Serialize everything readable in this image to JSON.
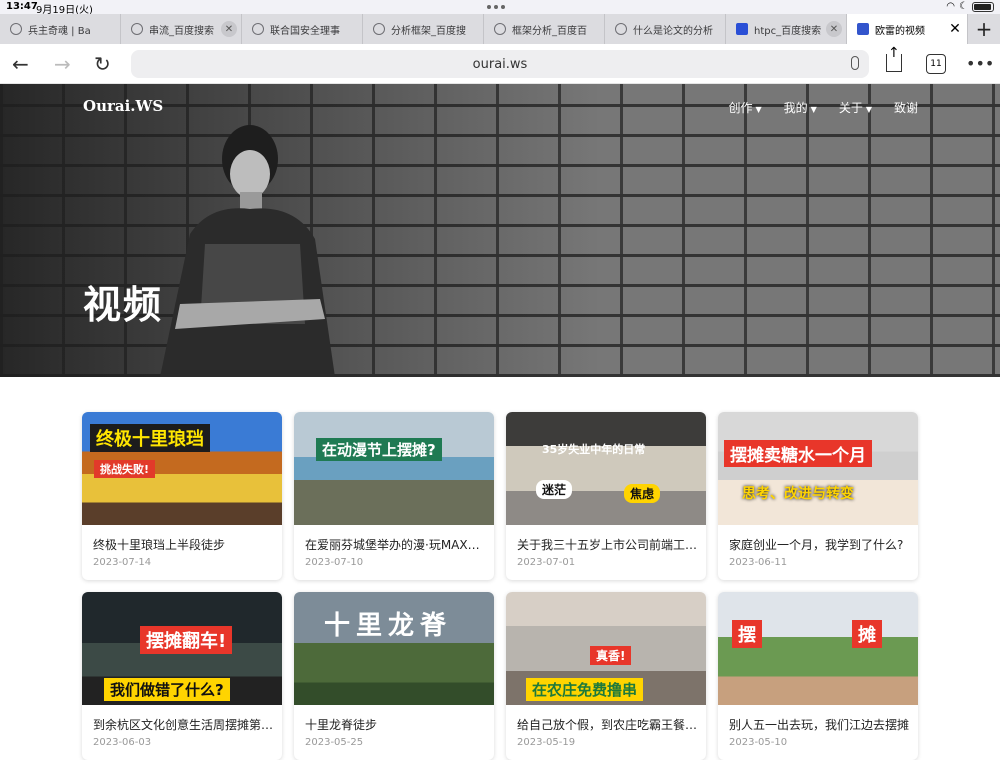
{
  "status": {
    "time": "13:47",
    "date": "9月19日(火)",
    "battery": "battery-icon"
  },
  "tabs": [
    {
      "label": "兵主奇魂 | Ba",
      "icon": "globe-icon",
      "active": false
    },
    {
      "label": "串流_百度搜索",
      "icon": "globe-icon",
      "active": false
    },
    {
      "label": "联合国安全理事",
      "icon": "globe-icon",
      "active": false
    },
    {
      "label": "分析框架_百度搜",
      "icon": "globe-icon",
      "active": false
    },
    {
      "label": "框架分析_百度百",
      "icon": "globe-icon",
      "active": false
    },
    {
      "label": "什么是论文的分析",
      "icon": "globe-icon",
      "active": false
    },
    {
      "label": "htpc_百度搜索",
      "icon": "baidu-icon",
      "active": false
    },
    {
      "label": "欧雷的视频",
      "icon": "site-icon",
      "active": true
    }
  ],
  "toolbar": {
    "url": "ourai.ws",
    "tab_count": "11"
  },
  "site": {
    "logo": "Ourai.WS",
    "nav": [
      {
        "label": "创作",
        "dropdown": true
      },
      {
        "label": "我的",
        "dropdown": true
      },
      {
        "label": "关于",
        "dropdown": true
      },
      {
        "label": "致谢",
        "dropdown": false
      }
    ],
    "title": "视频"
  },
  "videos": [
    {
      "title": "终极十里琅珰上半段徒步",
      "date": "2023-07-14",
      "thumb_text": [
        "终极十里琅珰",
        "挑战失败!"
      ]
    },
    {
      "title": "在爱丽芬城堡举办的漫·玩MAX…",
      "date": "2023-07-10",
      "thumb_text": [
        "在动漫节上摆摊?"
      ]
    },
    {
      "title": "关于我三十五岁上市公司前端工…",
      "date": "2023-07-01",
      "thumb_text": [
        "35岁失业中年的日常",
        "迷茫",
        "焦虑"
      ]
    },
    {
      "title": "家庭创业一个月，我学到了什么?",
      "date": "2023-06-11",
      "thumb_text": [
        "摆摊卖糖水一个月",
        "思考、改进与转变"
      ]
    },
    {
      "title": "到余杭区文化创意生活周摆摊第…",
      "date": "2023-06-03",
      "thumb_text": [
        "摆摊翻车!",
        "我们做错了什么?"
      ]
    },
    {
      "title": "十里龙脊徒步",
      "date": "2023-05-25",
      "thumb_text": [
        "十里龙脊"
      ]
    },
    {
      "title": "给自己放个假，到农庄吃霸王餐…",
      "date": "2023-05-19",
      "thumb_text": [
        "真香!",
        "在农庄免费撸串"
      ]
    },
    {
      "title": "别人五一出去玩，我们江边去摆摊",
      "date": "2023-05-10",
      "thumb_text": [
        "摆",
        "摊"
      ]
    }
  ]
}
